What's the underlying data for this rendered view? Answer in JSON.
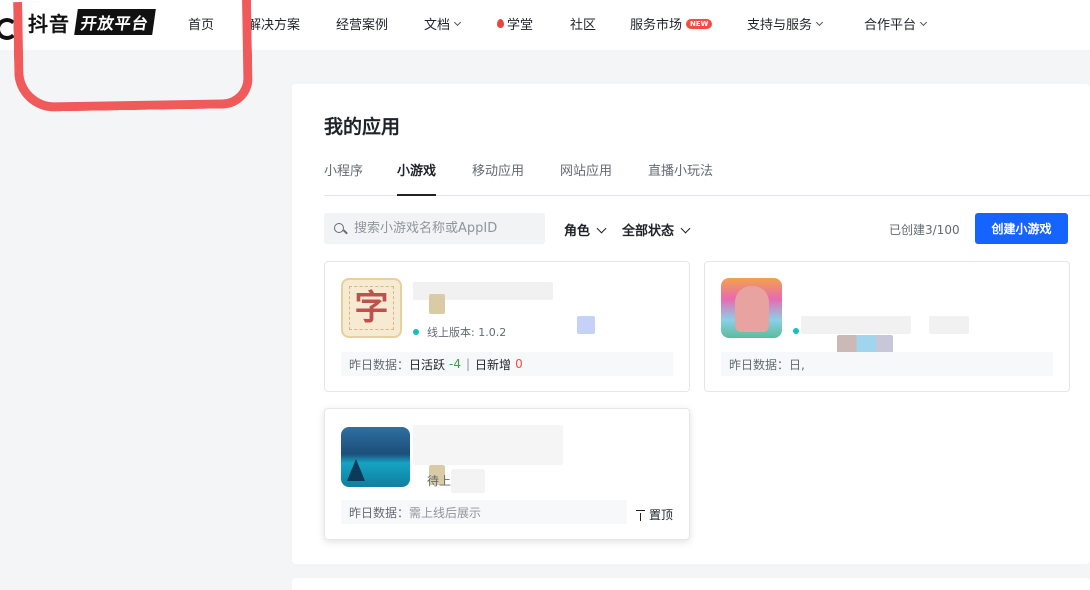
{
  "nav": {
    "brand": "抖音",
    "brand_badge": "开放平台",
    "items": [
      {
        "label": "首页"
      },
      {
        "label": "解决方案"
      },
      {
        "label": "经营案例"
      },
      {
        "label": "文档"
      },
      {
        "label": "学堂"
      },
      {
        "label": "社区"
      },
      {
        "label": "服务市场",
        "badge": "NEW"
      },
      {
        "label": "支持与服务"
      },
      {
        "label": "合作平台"
      }
    ]
  },
  "page": {
    "title": "我的应用",
    "tabs": [
      {
        "label": "小程序"
      },
      {
        "label": "小游戏",
        "active": true
      },
      {
        "label": "移动应用"
      },
      {
        "label": "网站应用"
      },
      {
        "label": "直播小玩法"
      }
    ]
  },
  "toolbar": {
    "search_placeholder": "搜索小游戏名称或AppID",
    "role_filter": "角色",
    "status_filter": "全部状态",
    "created_count": "已创建3/100",
    "create_button": "创建小游戏"
  },
  "apps": [
    {
      "icon_char": "字",
      "version": "线上版本: 1.0.2",
      "stats_label": "昨日数据：",
      "active_label": "日活跃",
      "active_value": "-4",
      "new_label": "日新增",
      "new_value": "0"
    },
    {
      "stats_label": "昨日数据：日,"
    },
    {
      "status": "待上",
      "stats_label": "昨日数据：",
      "stats_value": "需上线后展示",
      "pin_label": "置顶"
    }
  ],
  "colors": {
    "accent": "#1664ff",
    "positive": "#2aa84b",
    "negative": "#f54a45",
    "status_dot": "#14c0b8",
    "annotation": "#f05a5a"
  }
}
